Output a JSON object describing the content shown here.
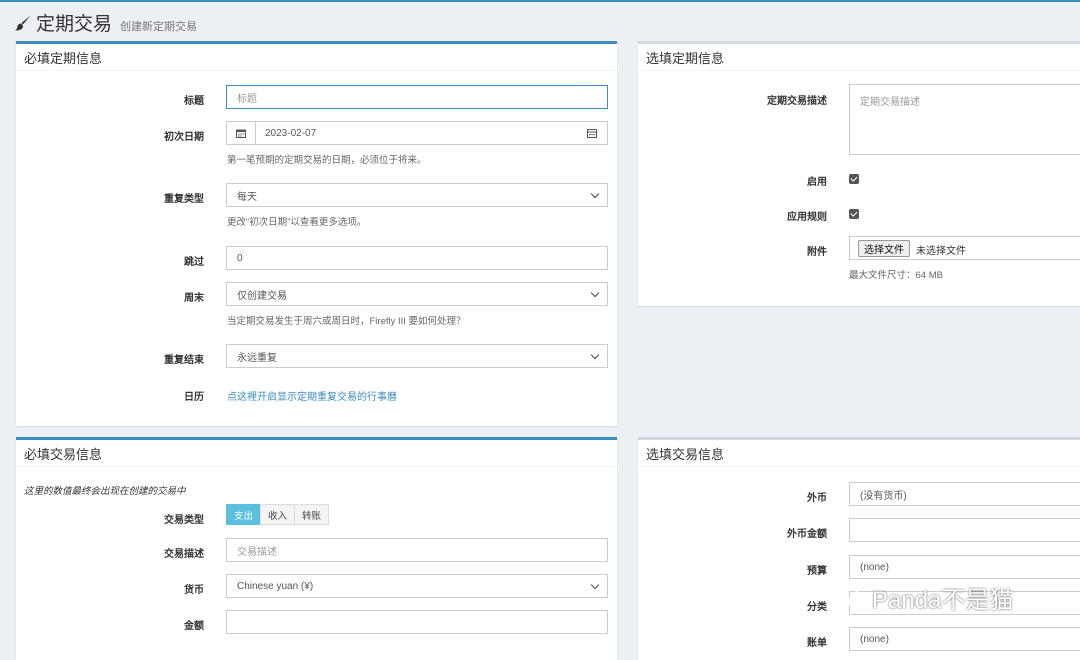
{
  "header": {
    "title": "定期交易",
    "subtitle": "创建新定期交易",
    "icon": "paintbrush-icon"
  },
  "required_recurrence": {
    "title": "必填定期信息",
    "title_field": {
      "label": "标题",
      "placeholder": "标题"
    },
    "first_date": {
      "label": "初次日期",
      "value": "2023-02-07",
      "help": "第一笔预期的定期交易的日期，必须位于将来。"
    },
    "repeat_type": {
      "label": "重复类型",
      "value": "每天",
      "help": "更改“初次日期”以查看更多选项。"
    },
    "skip": {
      "label": "跳过",
      "value": "0"
    },
    "weekend": {
      "label": "周末",
      "value": "仅创建交易",
      "help": "当定期交易发生于周六或周日时，Firefly III 要如何处理？"
    },
    "repeat_end": {
      "label": "重复结束",
      "value": "永远重复"
    },
    "calendar": {
      "label": "日历",
      "link": "点这裡开启显示定期重复交易的行事曆"
    }
  },
  "optional_recurrence": {
    "title": "选填定期信息",
    "description": {
      "label": "定期交易描述",
      "placeholder": "定期交易描述"
    },
    "active": {
      "label": "启用",
      "checked": true
    },
    "apply_rules": {
      "label": "应用规则",
      "checked": true
    },
    "attachments": {
      "label": "附件",
      "button": "选择文件",
      "no_file": "未选择文件",
      "help": "最大文件尺寸：64 MB"
    }
  },
  "required_transaction": {
    "title": "必填交易信息",
    "note": "这里的数值最终会出现在创建的交易中",
    "type": {
      "label": "交易类型",
      "options": [
        "支出",
        "收入",
        "转账"
      ],
      "active": "支出"
    },
    "description": {
      "label": "交易描述",
      "placeholder": "交易描述"
    },
    "currency": {
      "label": "货币",
      "value": "Chinese yuan (¥)"
    },
    "amount": {
      "label": "金额",
      "value": ""
    }
  },
  "optional_transaction": {
    "title": "选填交易信息",
    "foreign_currency": {
      "label": "外币",
      "value": "(没有货币)"
    },
    "foreign_amount": {
      "label": "外币金额",
      "value": ""
    },
    "budget": {
      "label": "预算",
      "value": "(none)"
    },
    "category": {
      "label": "分类",
      "value": ""
    },
    "bill": {
      "label": "账单",
      "value": "(none)"
    }
  },
  "watermark": {
    "text": "Panda不是猫",
    "icon": "wechat-icon"
  },
  "colors": {
    "primary": "#3c8dbc",
    "info": "#5bc0de",
    "background": "#ecf0f5"
  }
}
